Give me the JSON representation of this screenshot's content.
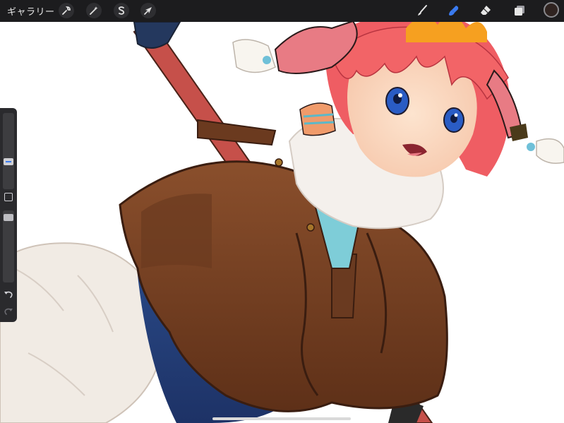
{
  "topbar": {
    "gallery_label": "ギャラリー",
    "left_tools": [
      {
        "icon": "wrench-icon",
        "name": "actions"
      },
      {
        "icon": "magic-wand-icon",
        "name": "adjustments"
      },
      {
        "icon": "selection-icon",
        "name": "selection"
      },
      {
        "icon": "arrow-cursor-icon",
        "name": "transform"
      }
    ],
    "right_tools": [
      {
        "icon": "brush-icon",
        "name": "paint"
      },
      {
        "icon": "smudge-icon",
        "name": "smudge",
        "active": true
      },
      {
        "icon": "eraser-icon",
        "name": "erase"
      },
      {
        "icon": "layers-icon",
        "name": "layers"
      }
    ],
    "active_color": "#2f2320",
    "accent_color": "#3a7bf0"
  },
  "sidebar": {
    "brush_size_level": 0.35,
    "opacity_level": 0.95
  }
}
